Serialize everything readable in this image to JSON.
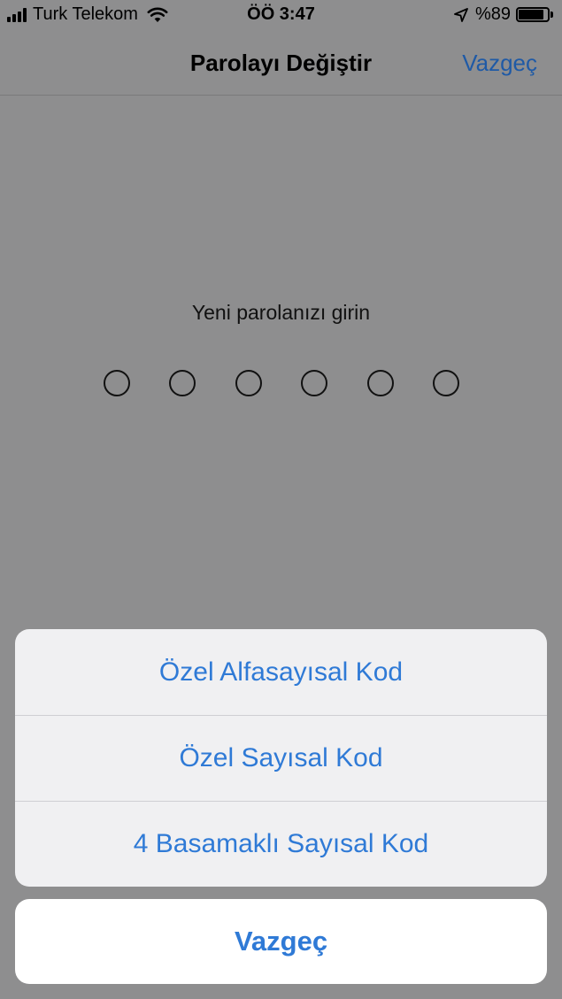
{
  "status_bar": {
    "carrier": "Turk Telekom",
    "time": "ÖÖ 3:47",
    "battery_percent": "%89",
    "battery_level": 0.89
  },
  "nav": {
    "title": "Parolayı Değiştir",
    "cancel_label": "Vazgeç"
  },
  "passcode": {
    "prompt": "Yeni parolanızı girin",
    "digit_count": 6
  },
  "action_sheet": {
    "options": [
      {
        "label": "Özel Alfasayısal Kod"
      },
      {
        "label": "Özel Sayısal Kod"
      },
      {
        "label": "4 Basamaklı Sayısal Kod"
      }
    ],
    "cancel_label": "Vazgeç"
  },
  "colors": {
    "accent": "#2f7ad6",
    "dim_background": "#8e8e8f"
  }
}
